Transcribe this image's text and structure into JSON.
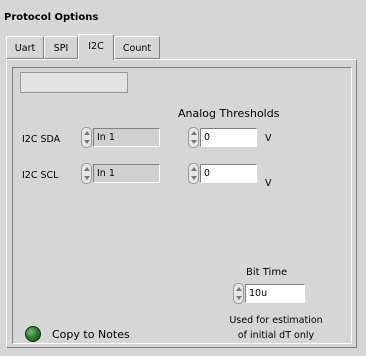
{
  "window": {
    "title": "Protocol Options"
  },
  "tabs": [
    {
      "label": "Uart",
      "active": false
    },
    {
      "label": "SPI",
      "active": false
    },
    {
      "label": "I2C",
      "active": true
    },
    {
      "label": "Count",
      "active": false
    }
  ],
  "analog_thresholds": {
    "heading": "Analog Thresholds",
    "unit": "V",
    "rows": [
      {
        "label": "I2C SDA",
        "channel": "In 1",
        "threshold": "0"
      },
      {
        "label": "I2C SCL",
        "channel": "In 1",
        "threshold": "0"
      }
    ]
  },
  "bit_time": {
    "label": "Bit Time",
    "value": "10u",
    "note_line1": "Used for estimation",
    "note_line2": "of  initial dT only"
  },
  "copy_to_notes": {
    "label": "Copy to Notes",
    "led_color": "#2f7f2f"
  }
}
